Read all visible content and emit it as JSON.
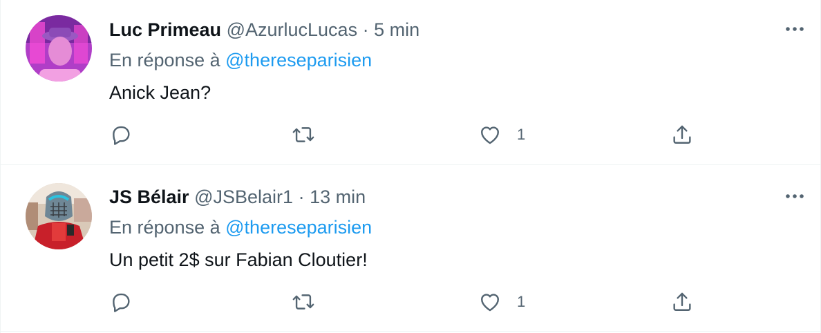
{
  "tweets": [
    {
      "author_name": "Luc Primeau",
      "handle": "@AzurlucLucas",
      "separator": "·",
      "time": "5 min",
      "reply_prefix": "En réponse à",
      "reply_to": "@thereseparisien",
      "text": "Anick Jean?",
      "likes": "1",
      "avatar_colors": {
        "bg": "#c64fd8",
        "accent": "#ff5bd0",
        "face": "#e58cd6"
      }
    },
    {
      "author_name": "JS Bélair",
      "handle": "@JSBelair1",
      "separator": "·",
      "time": "13 min",
      "reply_prefix": "En réponse à",
      "reply_to": "@thereseparisien",
      "text": "Un petit 2$ sur Fabian Cloutier!",
      "likes": "1",
      "avatar_colors": {
        "bg": "#d9c9b8",
        "accent": "#c8202a",
        "face": "#6f8796"
      }
    }
  ],
  "icons": {
    "reply": "reply-bubble-icon",
    "retweet": "retweet-icon",
    "like": "heart-icon",
    "share": "share-icon",
    "more": "more-dots-icon"
  },
  "colors": {
    "text_primary": "#0f1419",
    "text_secondary": "#536471",
    "link": "#1d9bf0",
    "divider": "#eff3f4"
  }
}
